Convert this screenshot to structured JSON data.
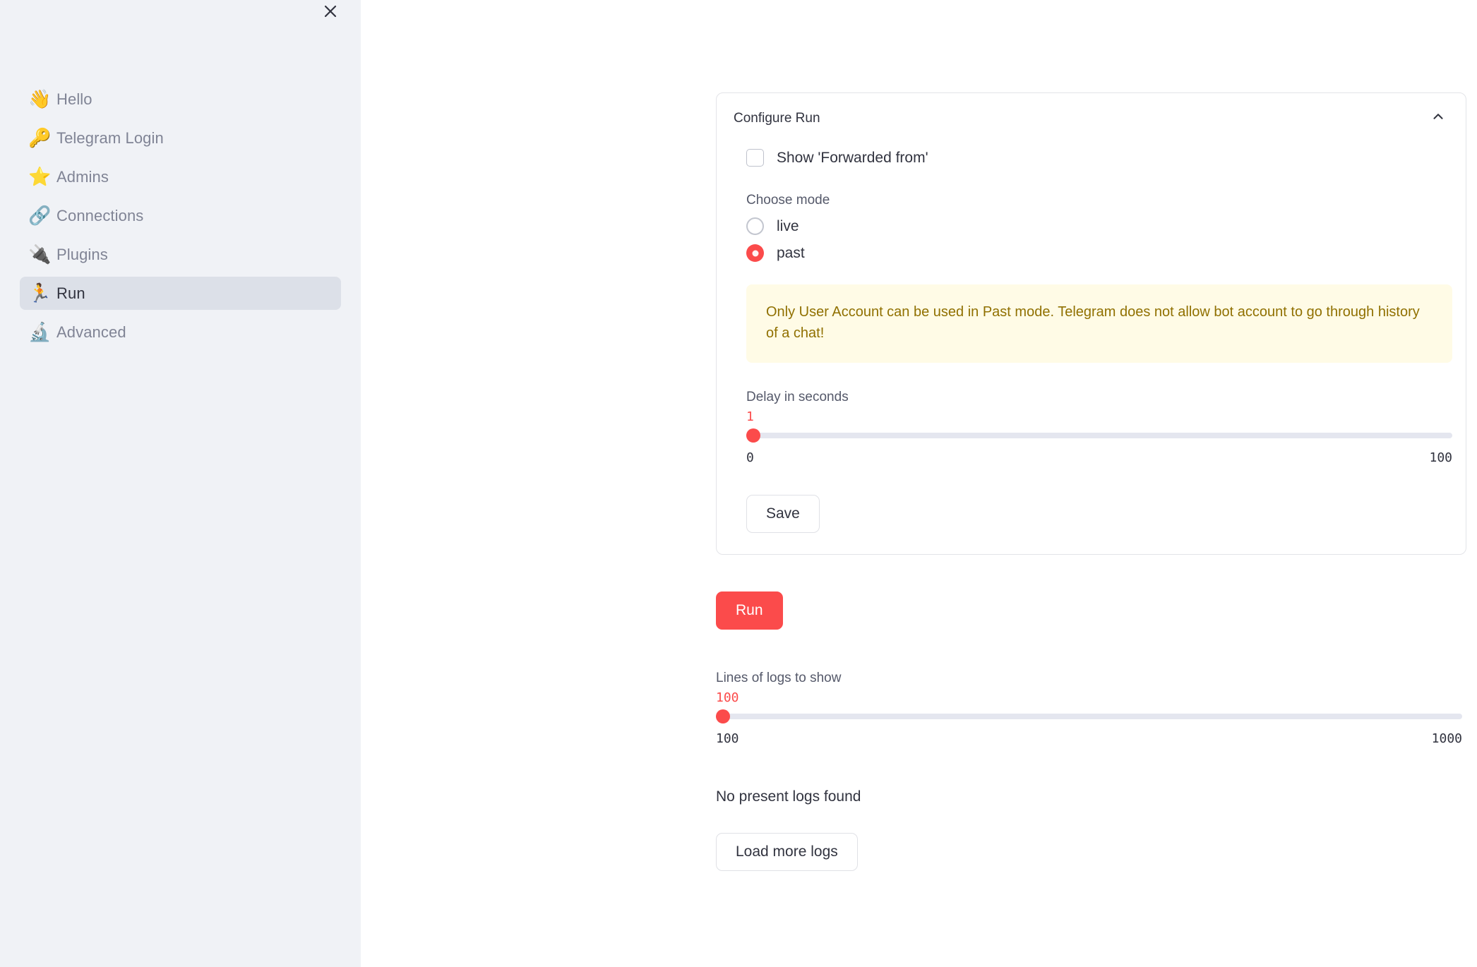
{
  "sidebar": {
    "close_icon": "close-icon",
    "items": [
      {
        "icon": "👋",
        "icon_name": "waving-hand-emoji",
        "label": "Hello",
        "active": false
      },
      {
        "icon": "🔑",
        "icon_name": "key-emoji",
        "label": "Telegram Login",
        "active": false
      },
      {
        "icon": "⭐",
        "icon_name": "star-emoji",
        "label": "Admins",
        "active": false
      },
      {
        "icon": "🔗",
        "icon_name": "link-emoji",
        "label": "Connections",
        "active": false
      },
      {
        "icon": "🔌",
        "icon_name": "electric-plug-emoji",
        "label": "Plugins",
        "active": false
      },
      {
        "icon": "🏃",
        "icon_name": "runner-emoji",
        "label": "Run",
        "active": true
      },
      {
        "icon": "🔬",
        "icon_name": "microscope-emoji",
        "label": "Advanced",
        "active": false
      }
    ]
  },
  "main": {
    "expander": {
      "title": "Configure Run",
      "collapse_icon": "chevron-up-icon",
      "checkbox": {
        "label": "Show 'Forwarded from'",
        "checked": false
      },
      "mode": {
        "label": "Choose mode",
        "options": [
          {
            "label": "live",
            "selected": false
          },
          {
            "label": "past",
            "selected": true
          }
        ]
      },
      "alert": {
        "text": "Only User Account can be used in Past mode. Telegram does not allow bot account to go through history of a chat!",
        "color": "#907000",
        "background": "#FFFBE6"
      },
      "delay_slider": {
        "label": "Delay in seconds",
        "value": "1",
        "min": "0",
        "max": "100",
        "percent": 1
      },
      "save_label": "Save"
    },
    "run_label": "Run",
    "logs_slider": {
      "label": "Lines of logs to show",
      "value": "100",
      "min": "100",
      "max": "1000",
      "percent": 0
    },
    "status_text": "No present logs found",
    "load_more_label": "Load more logs"
  },
  "theme": {
    "accent": "#FB4B4B",
    "sidebar_bg": "#F0F2F6",
    "sidebar_active_bg": "#DCE0E8",
    "text": "#31333F",
    "muted_text": "#808495"
  }
}
